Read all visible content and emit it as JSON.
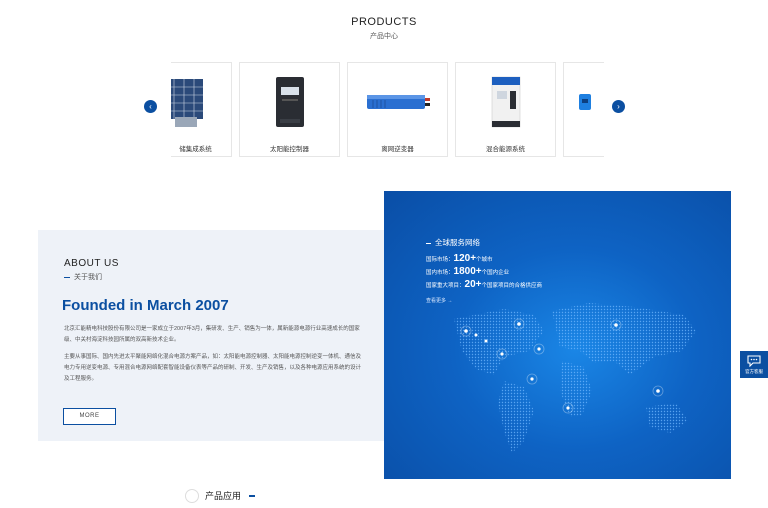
{
  "products": {
    "title": "PRODUCTS",
    "subtitle": "产品中心",
    "items": [
      {
        "label": "储集成系统",
        "icon": "solar-panel-icon"
      },
      {
        "label": "太阳能控制器",
        "icon": "solar-controller-icon"
      },
      {
        "label": "离网逆变器",
        "icon": "inverter-icon"
      },
      {
        "label": "混合能源系统",
        "icon": "hybrid-energy-icon"
      },
      {
        "label": "",
        "icon": "device-icon"
      }
    ],
    "prev_label": "‹",
    "next_label": "›"
  },
  "about": {
    "title": "ABOUT US",
    "subtitle": "关于我们",
    "headline": "Founded in March 2007",
    "paragraph1": "北京汇能精电科技股份有限公司是一家成立于2007年3月，集研发、生产、销售为一体，属新能源电源行业高速成长的国家级、中关村海淀科技园所属的双高新技术企业。",
    "paragraph2": "主要从事国际、国内先进太平聚能网络化混合电源方案产品，如：太阳能电源控制器、太阳能电源控制逆变一体机、通信及电力专用逆变电源、专用混合电源网络配套智能设备仪表等产品的研制、开发、生产及销售，以及各种电源应用系统的设计及工程服务。",
    "more_label": "MORE"
  },
  "network": {
    "title": "全球服务网络",
    "stats": [
      {
        "prefix": "国际市场：",
        "value": "120",
        "suffix": "+",
        "unit": "个城市"
      },
      {
        "prefix": "国内市场：",
        "value": "1800",
        "suffix": "+",
        "unit": "个国内企业"
      },
      {
        "prefix": "国家重大项目：",
        "value": "20",
        "suffix": "+",
        "unit": "个国家项目的合格供应商"
      }
    ],
    "more_label": "查看更多 →"
  },
  "side": {
    "label": "官方客服",
    "icon": "chat-icon"
  },
  "apps": {
    "title": "产品应用"
  },
  "colors": {
    "brand": "#0b4fa1",
    "map_blue": "#0e63c4",
    "about_bg": "#eef2f8"
  }
}
